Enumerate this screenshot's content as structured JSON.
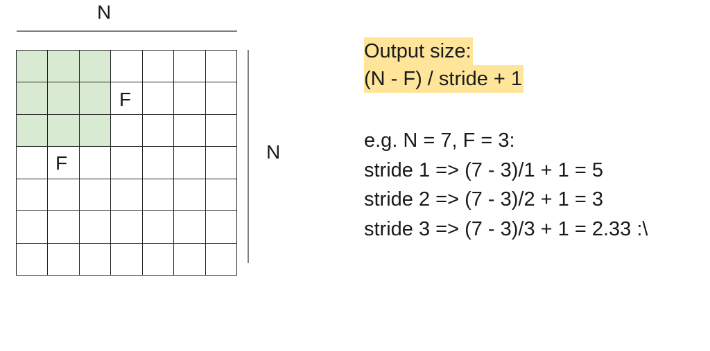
{
  "labels": {
    "n_top": "N",
    "n_side": "N",
    "f_right": "F",
    "f_below": "F"
  },
  "grid": {
    "size": 7,
    "filter_size": 3,
    "filter_color": "#d9ead3"
  },
  "formula": {
    "title": "Output size:",
    "expression": "(N - F) / stride + 1",
    "highlight_color": "#ffe599"
  },
  "examples": {
    "heading": "e.g. N = 7, F = 3:",
    "lines": [
      "stride 1 => (7 - 3)/1 + 1 = 5",
      "stride 2 => (7 - 3)/2 + 1 = 3",
      "stride 3 => (7 - 3)/3 + 1 = 2.33 :\\"
    ]
  }
}
